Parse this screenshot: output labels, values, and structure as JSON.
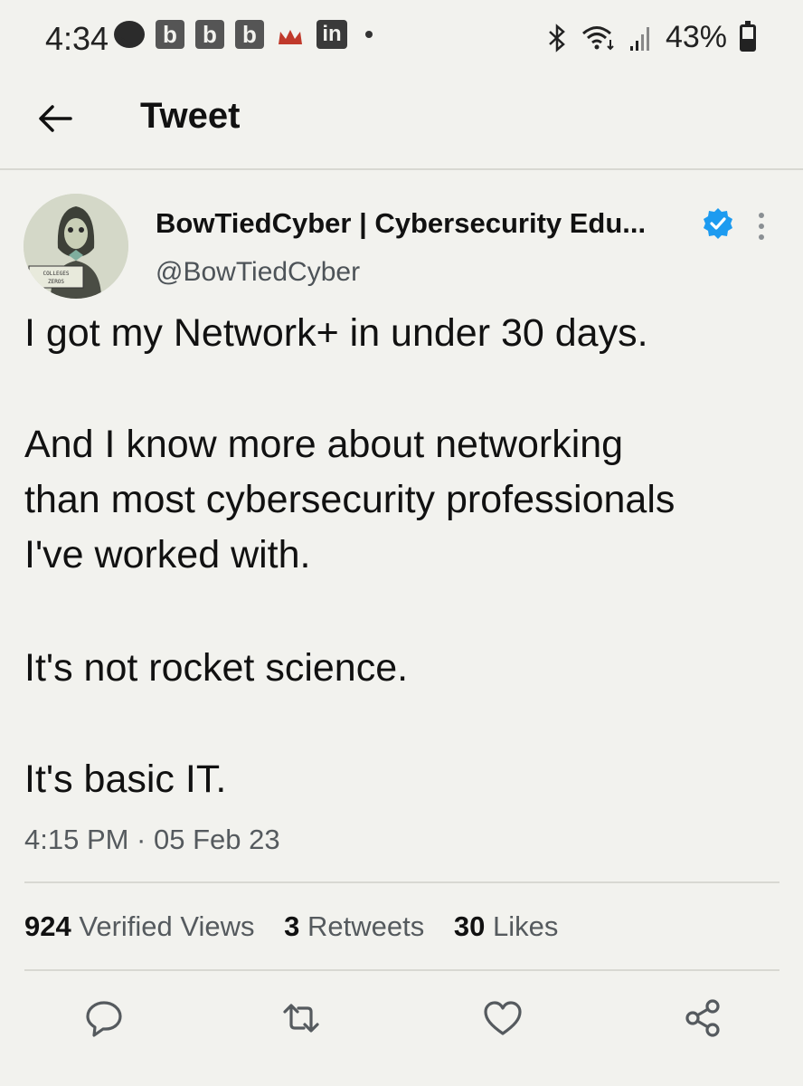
{
  "status_bar": {
    "time": "4:34",
    "notification_icons": [
      "chat-bubble-icon",
      "b-app-icon",
      "b-app-icon",
      "b-app-icon",
      "crown-icon",
      "linkedin-icon",
      "dot-icon"
    ],
    "b_label": "b",
    "in_label": "in",
    "battery_percent": "43%",
    "battery_level": 0.43,
    "system_icons": [
      "bluetooth-icon",
      "wifi-icon",
      "signal-icon",
      "battery-icon"
    ]
  },
  "header": {
    "title": "Tweet",
    "back_icon": "back-arrow-icon"
  },
  "tweet": {
    "author_name": "BowTiedCyber | Cybersecurity Edu...",
    "author_handle": "@BowTiedCyber",
    "verified": true,
    "verified_color": "#1d9bf0",
    "text_lines": [
      "I got my Network+ in under 30 days.",
      "And I know more about networking",
      "than most cybersecurity professionals",
      "I've worked with.",
      "It's not rocket science.",
      "It's basic IT."
    ],
    "timestamp": "4:15 PM · 05 Feb 23",
    "avatar_caption": [
      "COLLEGES",
      "ZEROS"
    ]
  },
  "stats": {
    "views_count": "924",
    "views_label": "Verified Views",
    "retweets_count": "3",
    "retweets_label": "Retweets",
    "likes_count": "30",
    "likes_label": "Likes"
  },
  "actions": [
    "reply-icon",
    "retweet-icon",
    "like-icon",
    "share-icon"
  ]
}
